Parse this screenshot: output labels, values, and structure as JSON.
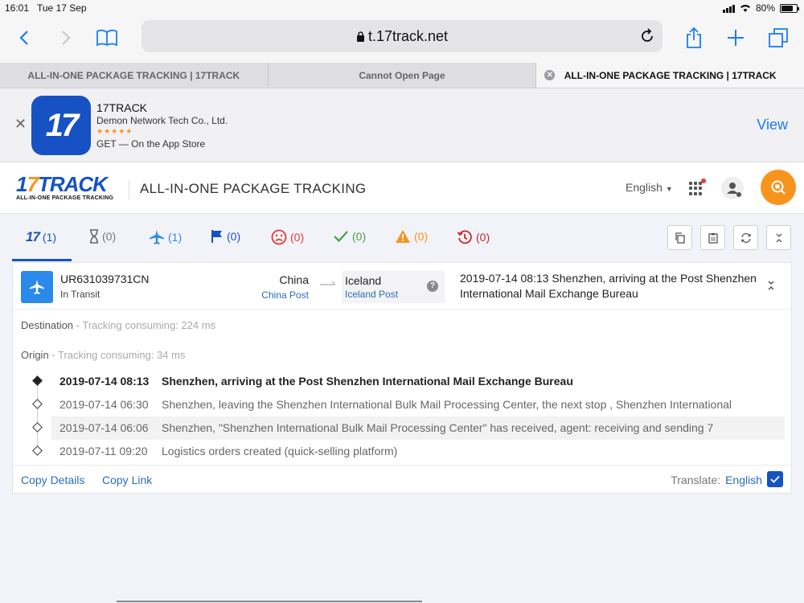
{
  "status": {
    "time": "16:01",
    "date": "Tue 17 Sep",
    "battery": "80%",
    "battery_level": 0.8
  },
  "browser": {
    "url": "t.17track.net",
    "tabs": [
      {
        "label": "ALL-IN-ONE PACKAGE TRACKING | 17TRACK"
      },
      {
        "label": "Cannot Open Page"
      },
      {
        "label": "ALL-IN-ONE PACKAGE TRACKING | 17TRACK",
        "active": true
      }
    ]
  },
  "banner": {
    "app_name": "17TRACK",
    "developer": "Demon Network Tech Co., Ltd.",
    "stars": "★★★★★",
    "get_text": "GET — On the App Store",
    "view_label": "View",
    "icon_text": "17"
  },
  "header": {
    "logo_main": "17TRACK",
    "logo_sub": "ALL-IN-ONE PACKAGE TRACKING",
    "title": "ALL-IN-ONE PACKAGE TRACKING",
    "language": "English"
  },
  "filters": [
    {
      "icon": "17-logo-icon",
      "count": "(1)",
      "color": "#1652c4"
    },
    {
      "icon": "hourglass-icon",
      "count": "(0)",
      "color": "#777777"
    },
    {
      "icon": "plane-icon",
      "count": "(1)",
      "color": "#2b8ae9"
    },
    {
      "icon": "flag-icon",
      "count": "(0)",
      "color": "#1652c4"
    },
    {
      "icon": "sad-face-icon",
      "count": "(0)",
      "color": "#e53935"
    },
    {
      "icon": "check-icon",
      "count": "(0)",
      "color": "#43a047"
    },
    {
      "icon": "warning-icon",
      "count": "(0)",
      "color": "#f7941d"
    },
    {
      "icon": "history-icon",
      "count": "(0)",
      "color": "#c62828"
    }
  ],
  "package": {
    "number": "UR631039731CN",
    "status": "In Transit",
    "origin_country": "China",
    "origin_carrier": "China Post",
    "dest_country": "Iceland",
    "dest_carrier": "Iceland Post",
    "latest": "2019-07-14 08:13  Shenzhen, arriving at the Post Shenzhen International Mail Exchange Bureau",
    "destination_label": "Destination",
    "destination_info": " - Tracking consuming: 224 ms",
    "origin_label": "Origin",
    "origin_info": " - Tracking consuming: 34 ms",
    "events": [
      {
        "time": "2019-07-14 08:13",
        "desc": "Shenzhen, arriving at the Post Shenzhen International Mail Exchange Bureau"
      },
      {
        "time": "2019-07-14 06:30",
        "desc": "Shenzhen, leaving the Shenzhen International Bulk Mail Processing Center, the next stop , Shenzhen International"
      },
      {
        "time": "2019-07-14 06:06",
        "desc": "Shenzhen, \"Shenzhen International Bulk Mail Processing Center\" has received, agent: receiving and sending 7"
      },
      {
        "time": "2019-07-11 09:20",
        "desc": "Logistics orders created (quick-selling platform)"
      }
    ]
  },
  "actions": {
    "copy_details": "Copy Details",
    "copy_link": "Copy Link",
    "translate_label": "Translate:",
    "translate_lang": "English"
  }
}
